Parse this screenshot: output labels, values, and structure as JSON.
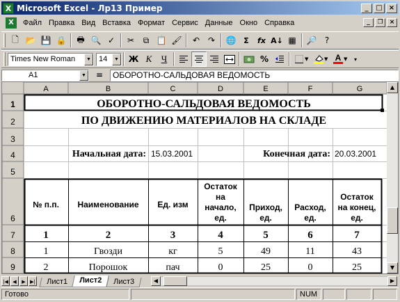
{
  "window": {
    "title": "Microsoft Excel - Лр13 Пример",
    "app_icon": "excel-icon",
    "controls": [
      "_",
      "□",
      "×"
    ]
  },
  "menu": [
    "Файл",
    "Правка",
    "Вид",
    "Вставка",
    "Формат",
    "Сервис",
    "Данные",
    "Окно",
    "Справка"
  ],
  "menu_underline": [
    "Ф",
    "П",
    "В",
    "т",
    "о",
    "С",
    "Д",
    "О",
    "С"
  ],
  "doc_controls": [
    "_",
    "❐",
    "×"
  ],
  "toolbar_std": [
    {
      "icon": "new-document-icon",
      "glyph": "🗋"
    },
    {
      "icon": "open-folder-icon",
      "glyph": "📂"
    },
    {
      "icon": "save-icon",
      "glyph": "💾"
    },
    {
      "icon": "permission-icon",
      "glyph": "🔒"
    },
    {
      "icon": "print-icon",
      "glyph": "🖶"
    },
    {
      "icon": "print-preview-icon",
      "glyph": "🔍"
    },
    {
      "icon": "spelling-icon",
      "glyph": "✓"
    },
    {
      "icon": "cut-icon",
      "glyph": "✂"
    },
    {
      "icon": "copy-icon",
      "glyph": "⧉"
    },
    {
      "icon": "paste-icon",
      "glyph": "📋"
    },
    {
      "icon": "format-painter-icon",
      "glyph": "🖌"
    },
    {
      "icon": "undo-icon",
      "glyph": "↶"
    },
    {
      "icon": "redo-icon",
      "glyph": "↷"
    },
    {
      "icon": "hyperlink-icon",
      "glyph": "🌐"
    },
    {
      "icon": "autosum-icon",
      "glyph": "Σ"
    },
    {
      "icon": "function-icon",
      "glyph": "fx"
    },
    {
      "icon": "sort-ascending-icon",
      "glyph": "A↓"
    },
    {
      "icon": "chart-wizard-icon",
      "glyph": "▦"
    },
    {
      "icon": "zoom-icon",
      "glyph": "🔎"
    },
    {
      "icon": "help-icon",
      "glyph": "?"
    }
  ],
  "toolbar_fmt": {
    "font": "Times New Roman",
    "size": "14",
    "bold": "Ж",
    "italic": "К",
    "underline": "Ч",
    "align_icons": [
      "align-left-icon",
      "align-center-icon",
      "align-right-icon",
      "merge-center-icon"
    ],
    "extra_icons": [
      "currency-icon",
      "percent-icon",
      "decrease-indent-icon",
      "borders-icon",
      "fill-color-icon",
      "font-color-icon"
    ],
    "percent": "%",
    "font_color_letter": "A"
  },
  "formula_bar": {
    "name_box": "A1",
    "eq": "=",
    "content": "ОБОРОТНО-САЛЬДОВАЯ ВЕДОМОСТЬ"
  },
  "columns": [
    "A",
    "B",
    "C",
    "D",
    "E",
    "F",
    "G"
  ],
  "rows": [
    "1",
    "2",
    "3",
    "4",
    "5",
    "6",
    "7",
    "8",
    "9"
  ],
  "cells": {
    "title1": "ОБОРОТНО-САЛЬДОВАЯ ВЕДОМОСТЬ",
    "title2": "ПО ДВИЖЕНИЮ МАТЕРИАЛОВ НА СКЛАДЕ",
    "start_label": "Начальная дата:",
    "start_date": "15.03.2001",
    "end_label": "Конечная дата:",
    "end_date": "20.03.2001",
    "headers": [
      "№ п.п.",
      "Наименование",
      "Ед. изм",
      "Остаток на начало, ед.",
      "Приход, ед.",
      "Расход, ед.",
      "Остаток на конец, ед."
    ],
    "header_lines": [
      [
        "№ п.п."
      ],
      [
        "Наименование"
      ],
      [
        "Ед. изм"
      ],
      [
        "Остаток",
        "на",
        "начало,",
        "ед."
      ],
      [
        "Приход,",
        "ед."
      ],
      [
        "Расход,",
        "ед."
      ],
      [
        "Остаток",
        "на конец,",
        "ед."
      ]
    ],
    "col_numbers": [
      "1",
      "2",
      "3",
      "4",
      "5",
      "6",
      "7"
    ],
    "data_rows": [
      [
        "1",
        "Гвозди",
        "кг",
        "5",
        "49",
        "11",
        "43"
      ],
      [
        "2",
        "Порошок",
        "пач",
        "0",
        "25",
        "0",
        "25"
      ]
    ]
  },
  "sheets": [
    "Лист1",
    "Лист2",
    "Лист3"
  ],
  "active_sheet": "Лист2",
  "status": {
    "ready": "Готово",
    "num": "NUM"
  }
}
